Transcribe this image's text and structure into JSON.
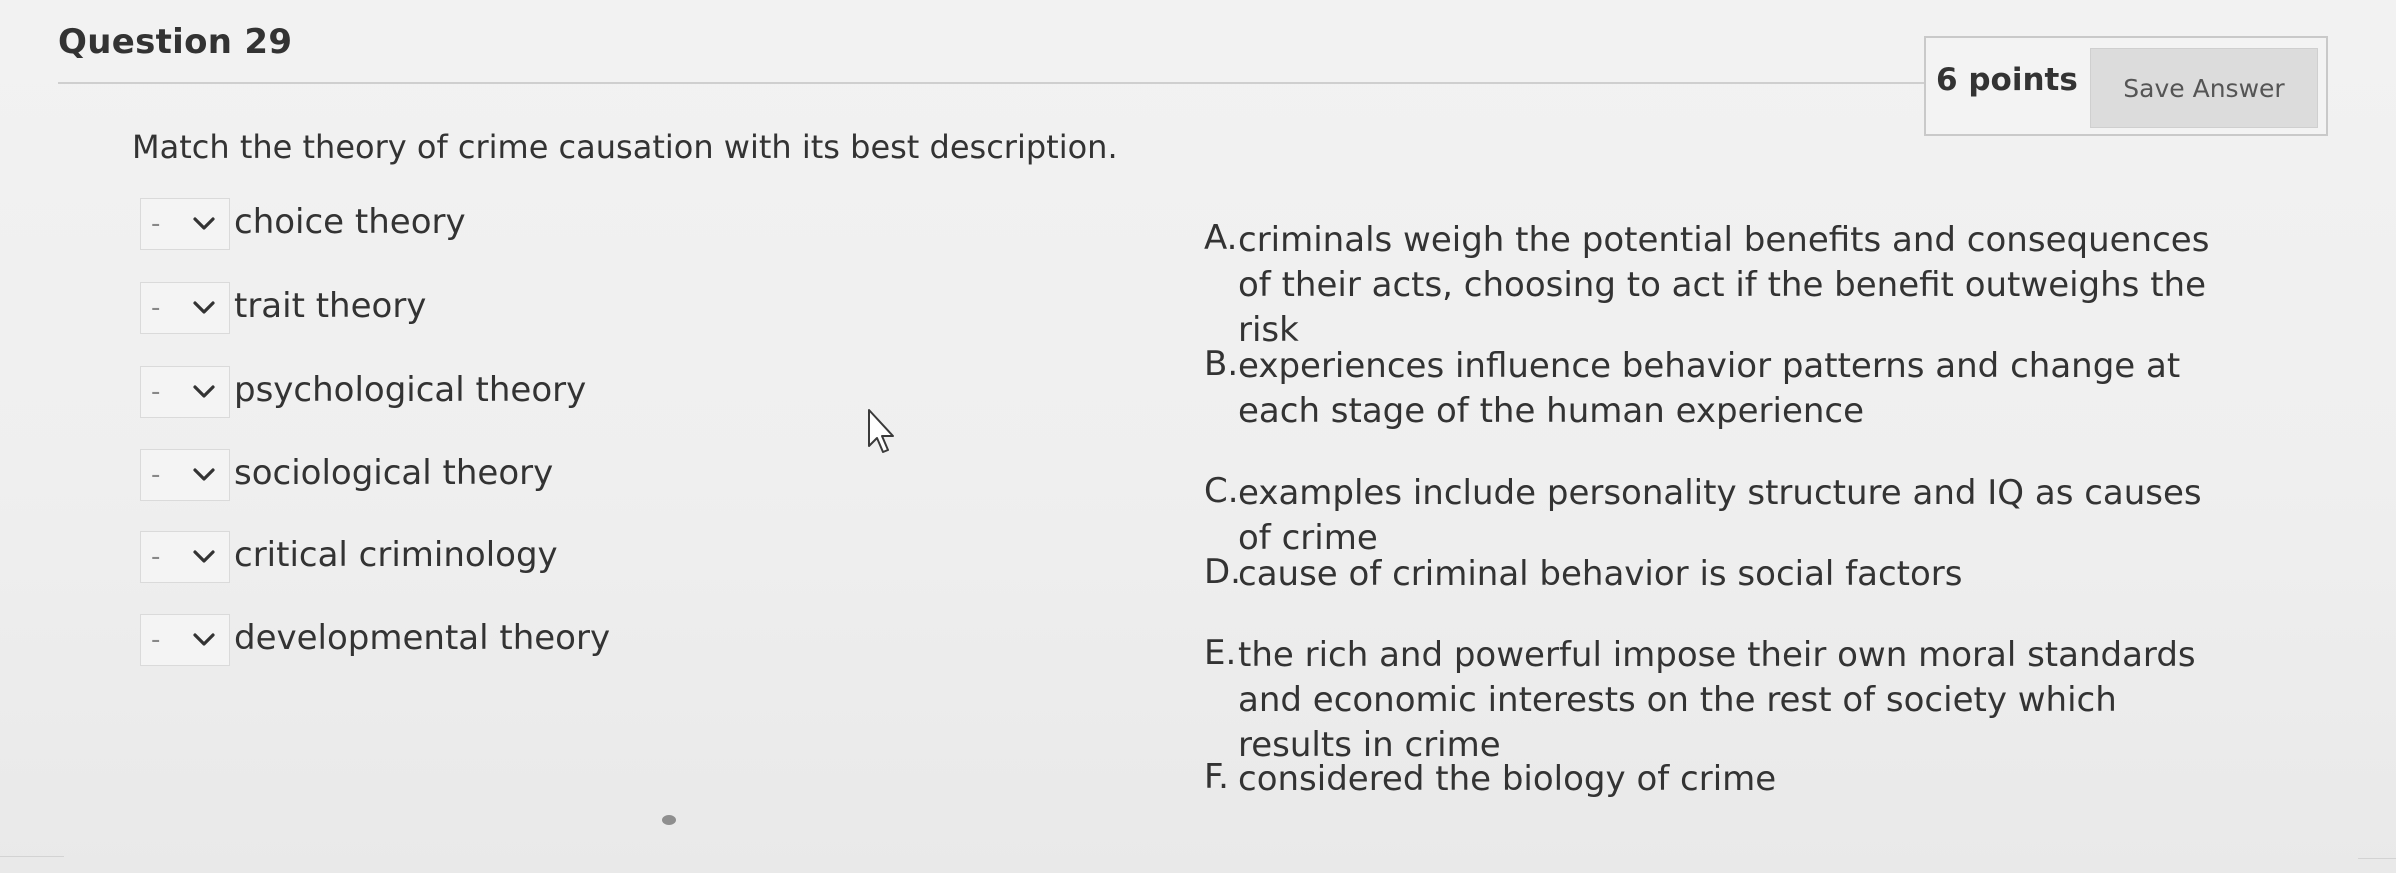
{
  "question": {
    "title": "Question 29",
    "points": "6 points",
    "save_label": "Save Answer",
    "instructions": "Match the theory of crime causation with its best description."
  },
  "matching": {
    "select_value": "-",
    "terms": [
      "choice theory",
      "trait theory",
      "psychological theory",
      "sociological theory",
      "critical criminology",
      "developmental theory"
    ],
    "answers": [
      {
        "letter": "A.",
        "text": "criminals weigh the potential benefits and consequences of their acts, choosing to act if the benefit outweighs the risk"
      },
      {
        "letter": "B.",
        "text": "experiences influence behavior patterns and change at each stage of the human experience"
      },
      {
        "letter": "C.",
        "text": "examples include personality structure and IQ as causes of crime"
      },
      {
        "letter": "D.",
        "text": "cause of criminal behavior is social factors"
      },
      {
        "letter": "E.",
        "text": "the rich and powerful impose their own moral standards and economic interests on the rest of society which results in crime"
      },
      {
        "letter": "F.",
        "text": "considered the biology of crime"
      }
    ]
  },
  "icons": {
    "select_arrow": "chevron-down-icon",
    "pointer": "mouse-cursor-icon"
  }
}
